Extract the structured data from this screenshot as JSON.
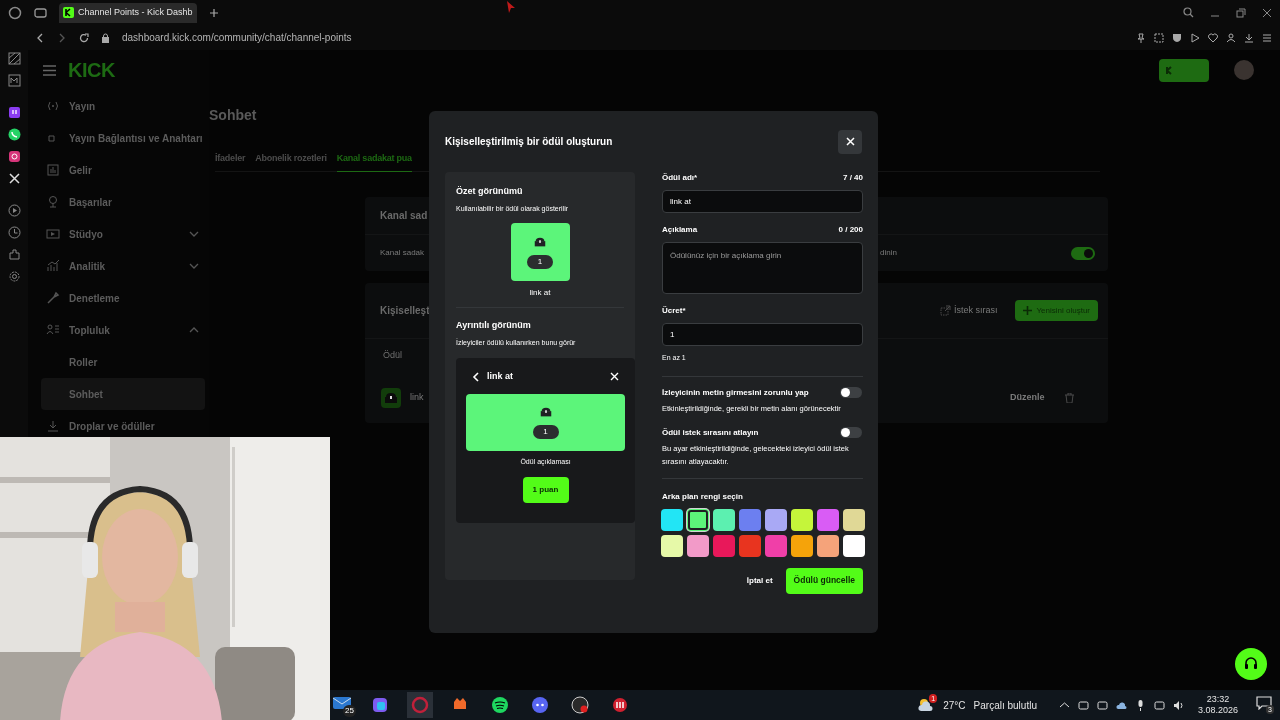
{
  "browser": {
    "tab_title": "Channel Points - Kick Dashb",
    "url": "dashboard.kick.com/community/chat/channel-points"
  },
  "sidebar": {
    "logo": "KICK",
    "items": [
      {
        "label": "Yayın",
        "selected": false
      },
      {
        "label": "Yayın Bağlantısı ve Anahtarı",
        "selected": false
      },
      {
        "label": "Gelir",
        "selected": false
      },
      {
        "label": "Başarılar",
        "selected": false
      },
      {
        "label": "Stüdyo",
        "selected": false,
        "expanded": false
      },
      {
        "label": "Analitik",
        "selected": false,
        "expanded": false
      },
      {
        "label": "Denetleme",
        "selected": false
      },
      {
        "label": "Topluluk",
        "selected": false,
        "expanded": true,
        "children": [
          {
            "label": "Roller",
            "selected": false
          },
          {
            "label": "Sohbet",
            "selected": true
          }
        ]
      },
      {
        "label": "Droplar ve ödüller",
        "selected": false
      }
    ]
  },
  "page": {
    "title": "Sohbet",
    "tabs": [
      {
        "label": "İfadeler",
        "selected": false
      },
      {
        "label": "Abonelik rozetleri",
        "selected": false
      },
      {
        "label": "Kanal sadakat pua",
        "selected": true
      }
    ],
    "card1": {
      "heading": "Kanal sad",
      "row_text": "Kanal sadak",
      "row_tail": "dinin",
      "toggle_on": true
    },
    "card2": {
      "heading": "Kişiselleşt",
      "queue_link": "İstek sırası",
      "create_button": "Yenisini oluştur",
      "column": "Ödül",
      "reward_name": "link",
      "edit": "Düzenle"
    }
  },
  "modal": {
    "title": "Kişiselleştirilmiş bir ödül oluşturun",
    "summary": {
      "heading": "Özet görünümü",
      "subtitle": "Kullanılabilir bir ödül olarak gösterilir",
      "cost": "1",
      "name": "link at"
    },
    "detail": {
      "heading": "Ayrıntılı görünüm",
      "subtitle": "İzleyiciler ödülü kullanırken bunu görür",
      "title": "link at",
      "cost": "1",
      "description": "Ödül açıklaması",
      "button": "1 puan"
    },
    "fields": [
      {
        "kind": "input",
        "label": "Ödül adı*",
        "counter": "7 / 40",
        "value": "link at"
      },
      {
        "kind": "textarea",
        "label": "Açıklama",
        "counter": "0 / 200",
        "placeholder": "Ödülünüz için bir açıklama girin"
      },
      {
        "kind": "input",
        "label": "Ücret*",
        "value": "1",
        "hint": "En az 1"
      }
    ],
    "toggles": [
      {
        "title": "İzleyicinin metin girmesini zorunlu yap",
        "description": "Etkinleştirildiğinde, gerekli bir metin alanı görünecektir",
        "on": false
      },
      {
        "title": "Ödül istek sırasını atlayın",
        "description": "Bu ayar etkinleştirildiğinde, gelecekteki izleyici ödül istek sırasını atlayacaktır.",
        "on": false
      }
    ],
    "color_heading": "Arka plan rengi seçin",
    "colors": [
      {
        "color": "#22e5f5",
        "selected": false
      },
      {
        "color": "#5cf57a",
        "selected": true
      },
      {
        "color": "#5cf0b0",
        "selected": false
      },
      {
        "color": "#6c7ff0",
        "selected": false
      },
      {
        "color": "#a9a9f5",
        "selected": false
      },
      {
        "color": "#c5f53a",
        "selected": false
      },
      {
        "color": "#d95cf5",
        "selected": false
      },
      {
        "color": "#e0d896",
        "selected": false
      },
      {
        "color": "#e6f9a8",
        "selected": false
      },
      {
        "color": "#f29ac8",
        "selected": false
      },
      {
        "color": "#e8185a",
        "selected": false
      },
      {
        "color": "#e8341f",
        "selected": false
      },
      {
        "color": "#f03fa8",
        "selected": false
      },
      {
        "color": "#f5a30a",
        "selected": false
      },
      {
        "color": "#f5a37a",
        "selected": false
      },
      {
        "color": "#ffffff",
        "selected": false
      }
    ],
    "cancel": "İptal et",
    "submit": "Ödülü güncelle"
  },
  "taskbar": {
    "mail_badge": "25",
    "weather_badge": "1",
    "temperature": "27°C",
    "weather": "Parçalı bulutlu",
    "time": "23:32",
    "date": "3.08.2026",
    "notifications": "3"
  }
}
